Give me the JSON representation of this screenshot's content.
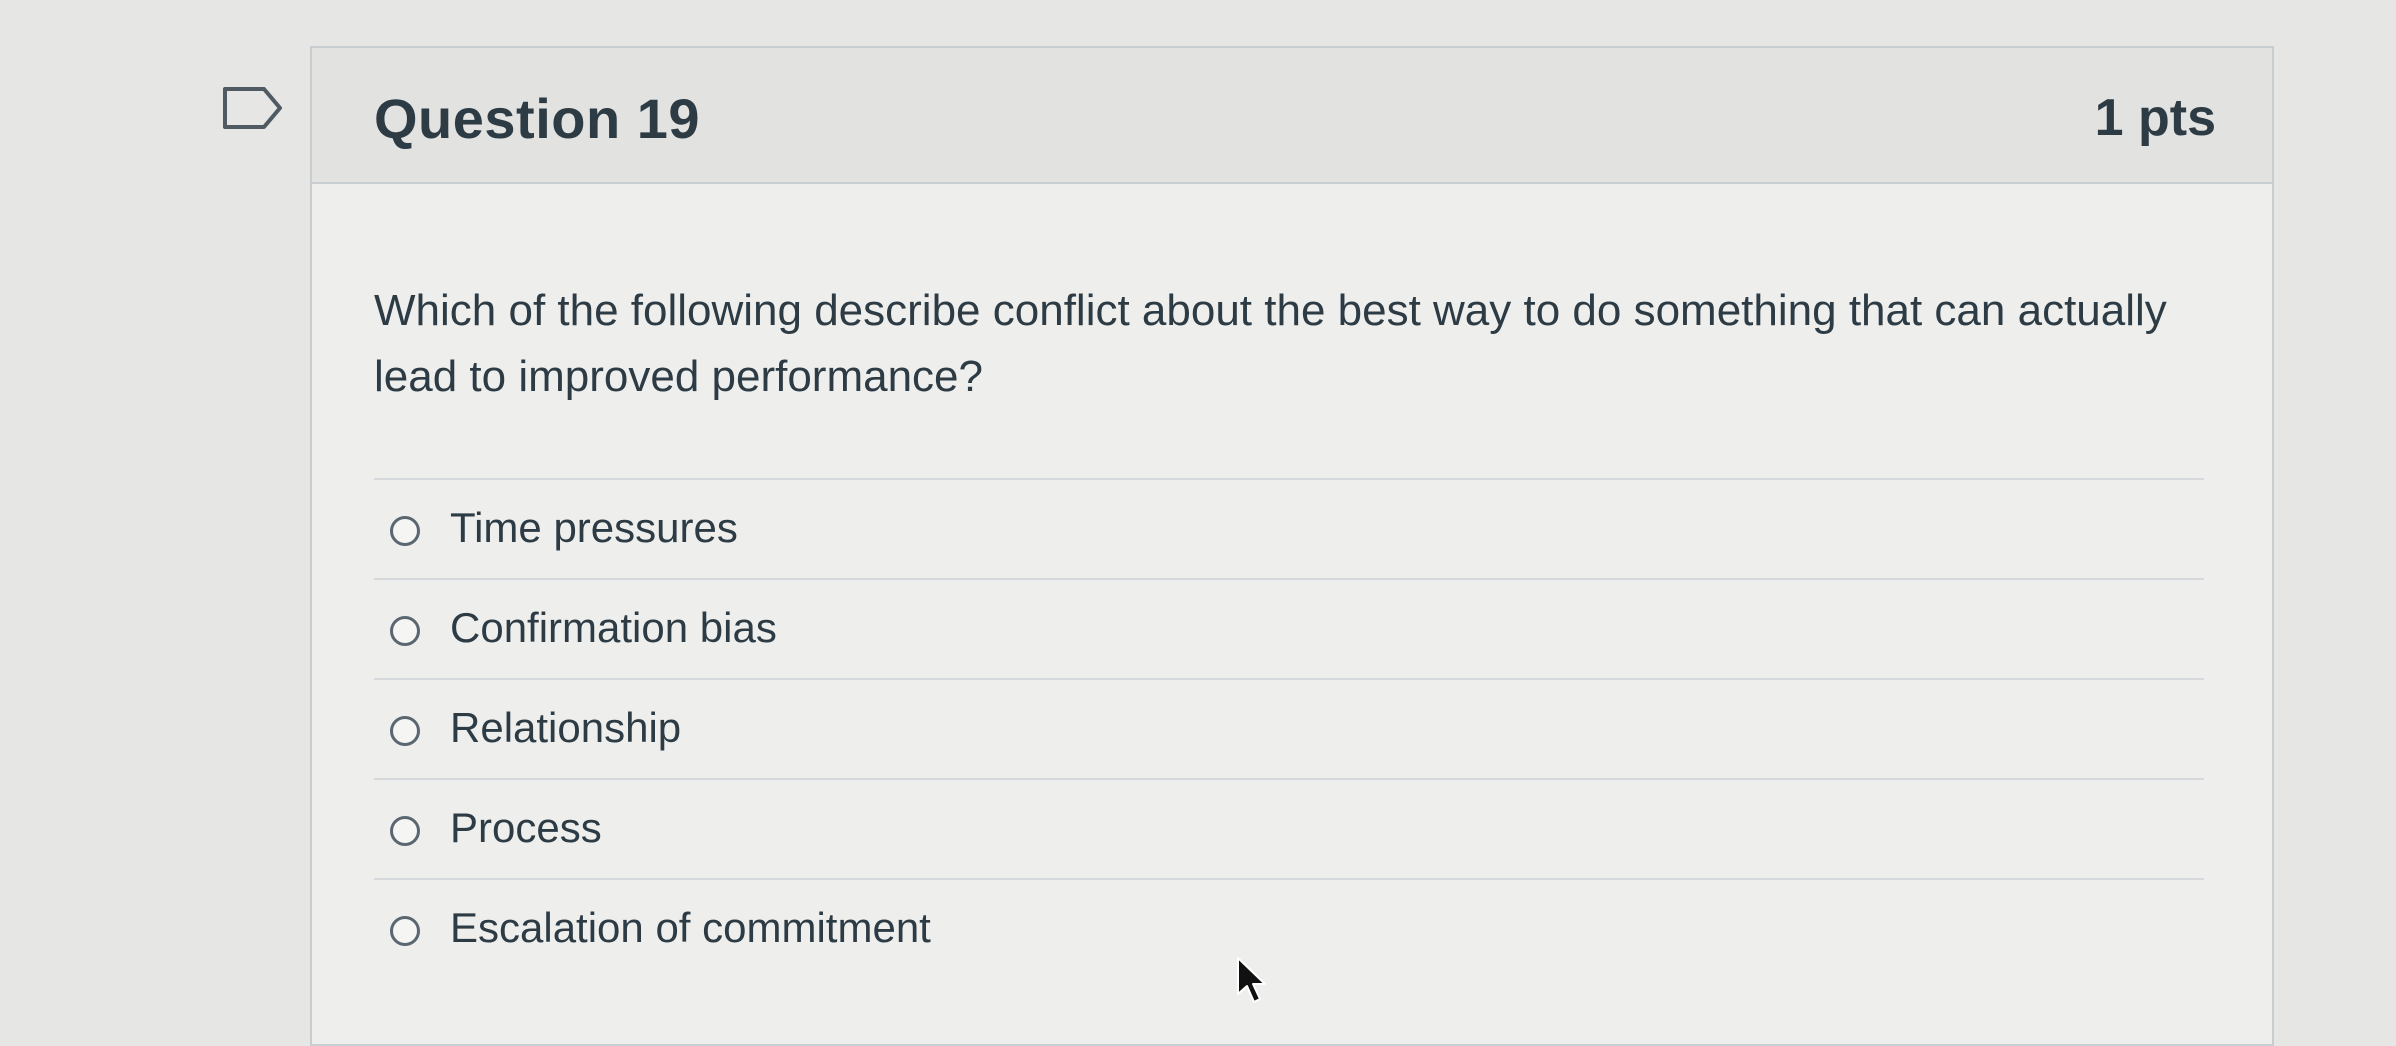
{
  "question": {
    "title": "Question 19",
    "points": "1 pts",
    "text": "Which of the following describe conflict about the best way to do something that can actually lead to improved performance?",
    "answers": [
      {
        "label": "Time pressures",
        "selected": false
      },
      {
        "label": "Confirmation bias",
        "selected": false
      },
      {
        "label": "Relationship",
        "selected": false
      },
      {
        "label": "Process",
        "selected": false
      },
      {
        "label": "Escalation of commitment",
        "selected": false
      }
    ]
  },
  "icons": {
    "flag": "flag-question-icon",
    "cursor": "mouse-pointer-icon"
  },
  "colors": {
    "text": "#2d3b45",
    "border": "#c7cdd1",
    "header_bg": "#e2e2e0",
    "card_bg": "#eeeeec"
  }
}
